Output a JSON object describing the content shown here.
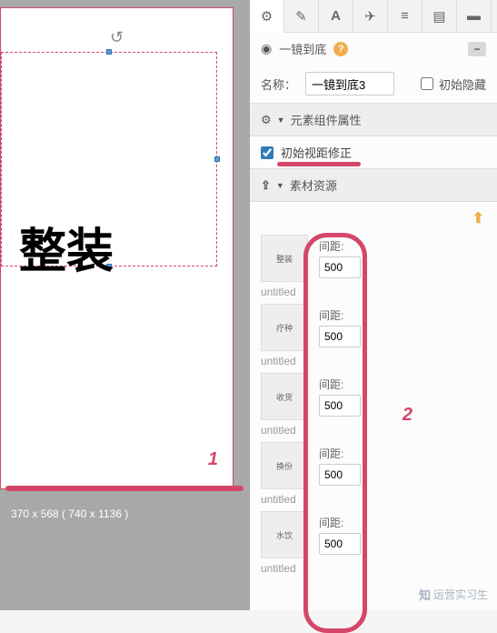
{
  "canvas": {
    "big_text": "整装",
    "dim_text": "370 x 568 ( 740 x 1136 )",
    "annot1": "1"
  },
  "header": {
    "title": "一镜到底"
  },
  "name_row": {
    "label": "名称：",
    "value": "一镜到底3",
    "hide_label": "初始隐藏"
  },
  "sections": {
    "component": "元素组件属性",
    "correction": "初始视距修正",
    "resources": "素材资源"
  },
  "resources": [
    {
      "thumb": "整装",
      "gap_label": "间距:",
      "gap_value": "500",
      "title": "untitled"
    },
    {
      "thumb": "疗种",
      "gap_label": "间距:",
      "gap_value": "500",
      "title": "untitled"
    },
    {
      "thumb": "收货",
      "gap_label": "间距:",
      "gap_value": "500",
      "title": "untitled"
    },
    {
      "thumb": "换份",
      "gap_label": "间距:",
      "gap_value": "500",
      "title": "untitled"
    },
    {
      "thumb": "水饮",
      "gap_label": "间距:",
      "gap_value": "500",
      "title": "untitled"
    }
  ],
  "annot2": "2",
  "watermark": "运营实习生"
}
